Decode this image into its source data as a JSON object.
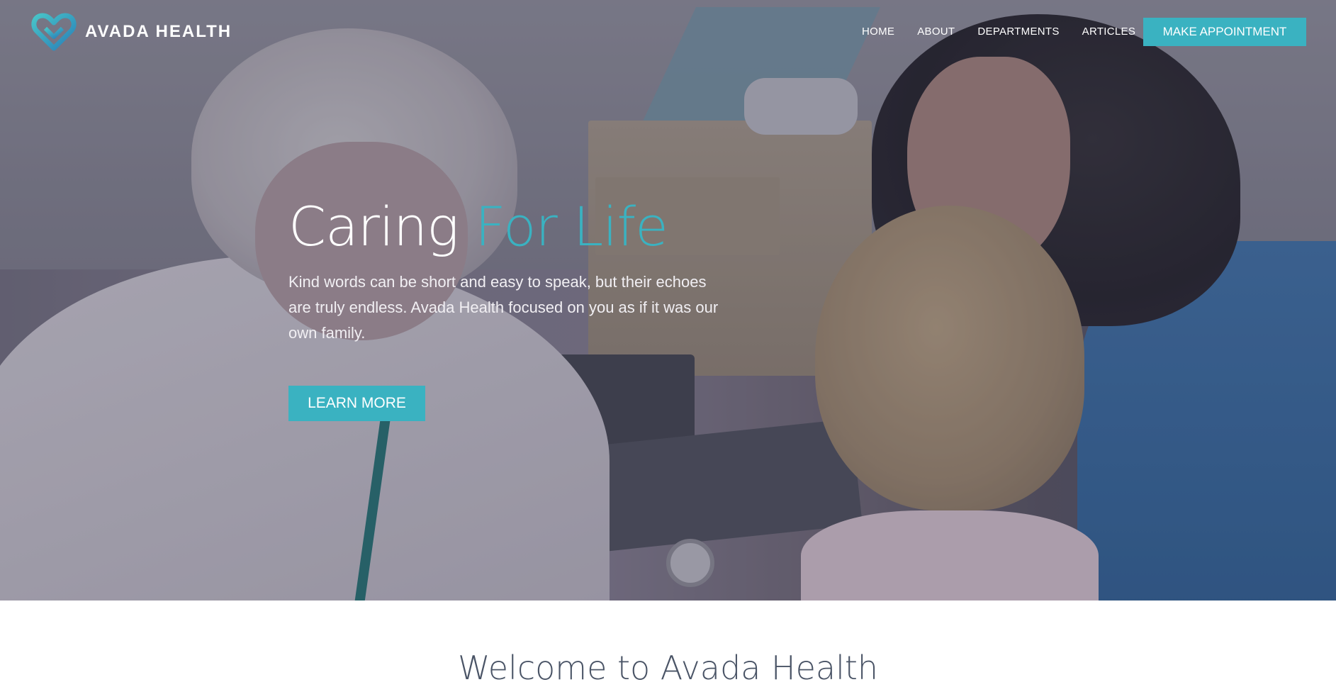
{
  "brand": {
    "name": "AVADA HEALTH",
    "accent_color": "#3ab2c1",
    "logo_icon": "heart-logo-icon"
  },
  "nav": {
    "items": [
      "HOME",
      "ABOUT",
      "DEPARTMENTS",
      "ARTICLES"
    ],
    "cta_label": "MAKE APPOINTMENT"
  },
  "hero": {
    "title_main": "Caring",
    "title_accent": "For Life",
    "subtitle": "Kind words can be short and easy to speak, but their echoes are truly endless. Avada Health focused on you as if it was our own family.",
    "button_label": "LEARN MORE"
  },
  "welcome": {
    "heading": "Welcome to Avada Health"
  }
}
